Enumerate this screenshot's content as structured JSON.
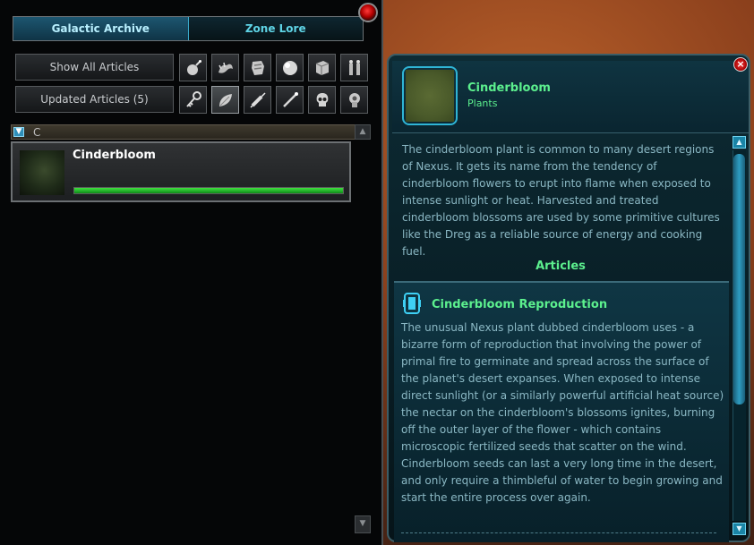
{
  "tabs": [
    {
      "label": "Galactic Archive",
      "active": true
    },
    {
      "label": "Zone Lore",
      "active": false
    }
  ],
  "filters": {
    "show_all": "Show All Articles",
    "updated": "Updated Articles (5)"
  },
  "category_icons": [
    "bomb-icon",
    "creature-icon",
    "tech-armor-icon",
    "orb-icon",
    "datacube-icon",
    "people-icon",
    "key-icon",
    "leaf-icon",
    "syringe-icon",
    "rod-icon",
    "skull-icon",
    "relic-icon"
  ],
  "list": {
    "letter": "C",
    "entries": [
      {
        "title": "Cinderbloom",
        "progress": 1.0
      }
    ]
  },
  "detail": {
    "title": "Cinderbloom",
    "category": "Plants",
    "description": "The cinderbloom plant is common to many desert regions of Nexus. It gets its name from the tendency of cinderbloom flowers to erupt into flame when exposed to intense sunlight or heat. Harvested and treated cinderbloom blossoms are used by some primitive cultures like the Dreg as a reliable source of energy and cooking fuel.",
    "articles_label": "Articles",
    "article": {
      "title": "Cinderbloom Reproduction",
      "body": "The unusual Nexus plant dubbed cinderbloom uses - a bizarre form of reproduction that involving the power of primal fire to germinate and spread across the surface of the planet's desert expanses. When exposed to intense direct sunlight (or a similarly powerful artificial heat source) the nectar on the cinderbloom's blossoms ignites, burning off the outer layer of the flower - which contains microscopic fertilized seeds that scatter on the wind. Cinderbloom seeds can last a very long time in the desert, and only require a thimbleful of water to begin growing and start the entire process over again."
    }
  },
  "colors": {
    "accent_green": "#5cf08e",
    "accent_cyan": "#5fd4e6",
    "body_text": "#8bb8c4"
  }
}
